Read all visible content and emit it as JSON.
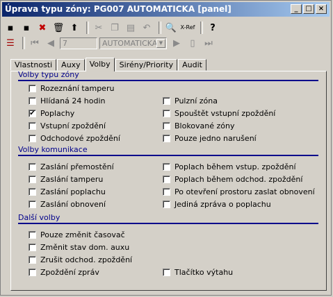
{
  "window": {
    "title": "Úprava typu zóny: PG007 AUTOMATICKA [panel]"
  },
  "toolbar": {
    "record_field": "7",
    "zone_select": "AUTOMATICKA",
    "xref_label": "X-Ref"
  },
  "tabs": [
    "Vlastnosti",
    "Auxy",
    "Volby",
    "Sirény/Priority",
    "Audit"
  ],
  "active_tab": "Volby",
  "sections": {
    "zone_options": {
      "title": "Volby typu zóny",
      "left": [
        {
          "label": "Rozeznání tamperu",
          "checked": false
        },
        {
          "label": "Hlídaná 24 hodin",
          "checked": false
        },
        {
          "label": "Poplachy",
          "checked": true
        },
        {
          "label": "Vstupní zpoždění",
          "checked": false
        },
        {
          "label": "Odchodové zpoždění",
          "checked": false
        }
      ],
      "right": [
        {
          "label": "Pulzní zóna",
          "checked": false
        },
        {
          "label": "Spouštět vstupní zpoždění",
          "checked": false
        },
        {
          "label": "Blokované zóny",
          "checked": false
        },
        {
          "label": "Pouze jedno narušení",
          "checked": false
        }
      ]
    },
    "comm_options": {
      "title": "Volby komunikace",
      "left": [
        {
          "label": "Zaslání přemostění",
          "checked": false
        },
        {
          "label": "Zaslání tamperu",
          "checked": false
        },
        {
          "label": "Zaslání poplachu",
          "checked": false
        },
        {
          "label": "Zaslání obnovení",
          "checked": false
        }
      ],
      "right": [
        {
          "label": "Poplach během vstup. zpoždění",
          "checked": false
        },
        {
          "label": "Poplach během odchod. zpoždění",
          "checked": false
        },
        {
          "label": "Po otevření prostoru zaslat obnovení",
          "checked": false
        },
        {
          "label": "Jediná zpráva o poplachu",
          "checked": false
        }
      ]
    },
    "other_options": {
      "title": "Další volby",
      "left": [
        {
          "label": "Pouze změnit časovač",
          "checked": false
        },
        {
          "label": "Změnit stav dom. auxu",
          "checked": false
        },
        {
          "label": "Zrušit odchod. zpoždění",
          "checked": false
        },
        {
          "label": "Zpoždění zpráv",
          "checked": false
        }
      ],
      "right": [
        {
          "label": "Tlačítko výtahu",
          "checked": false
        }
      ]
    }
  }
}
